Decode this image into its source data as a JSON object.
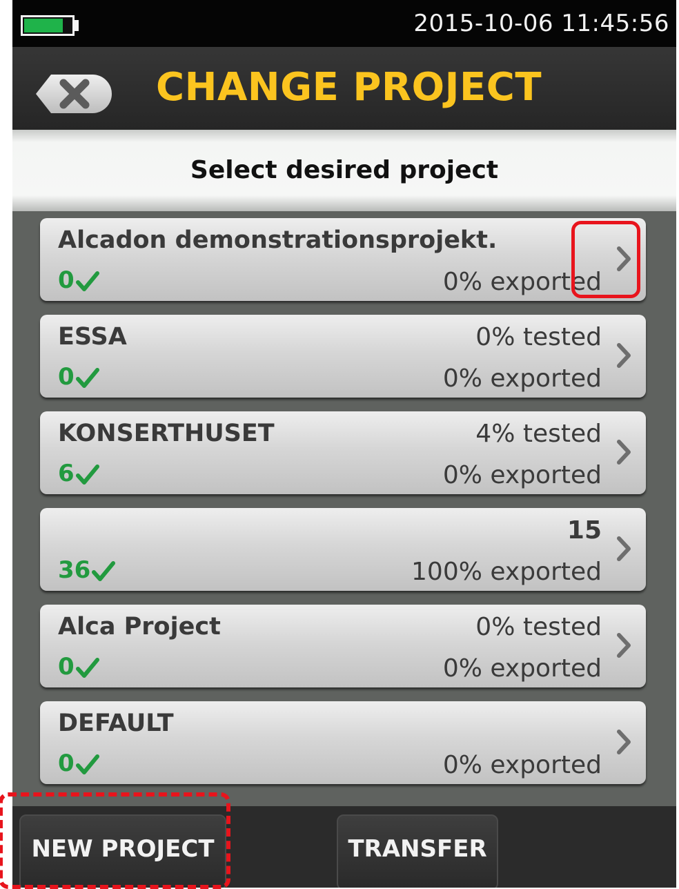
{
  "status_bar": {
    "battery_level": 0.78,
    "datetime": "2015-10-06 11:45:56"
  },
  "header": {
    "title": "CHANGE PROJECT",
    "back_icon": "close-x-icon"
  },
  "subheader": {
    "text": "Select desired project"
  },
  "projects": [
    {
      "name": "Alcadon demonstrationsprojekt.",
      "tested": "",
      "count": "0",
      "exported": "0% exported"
    },
    {
      "name": "ESSA",
      "tested": "0% tested",
      "count": "0",
      "exported": "0% exported"
    },
    {
      "name": "KONSERTHUSET",
      "tested": "4% tested",
      "count": "6",
      "exported": "0% exported"
    },
    {
      "name": "",
      "tested": "15",
      "count": "36",
      "exported": "100% exported"
    },
    {
      "name": "Alca Project",
      "tested": "0% tested",
      "count": "0",
      "exported": "0% exported"
    },
    {
      "name": "DEFAULT",
      "tested": "",
      "count": "0",
      "exported": "0% exported"
    }
  ],
  "footer": {
    "new_project_label": "NEW PROJECT",
    "transfer_label": "TRANSFER"
  },
  "colors": {
    "title": "#fbc41f",
    "check": "#229a3f",
    "highlight": "#e8141c"
  }
}
